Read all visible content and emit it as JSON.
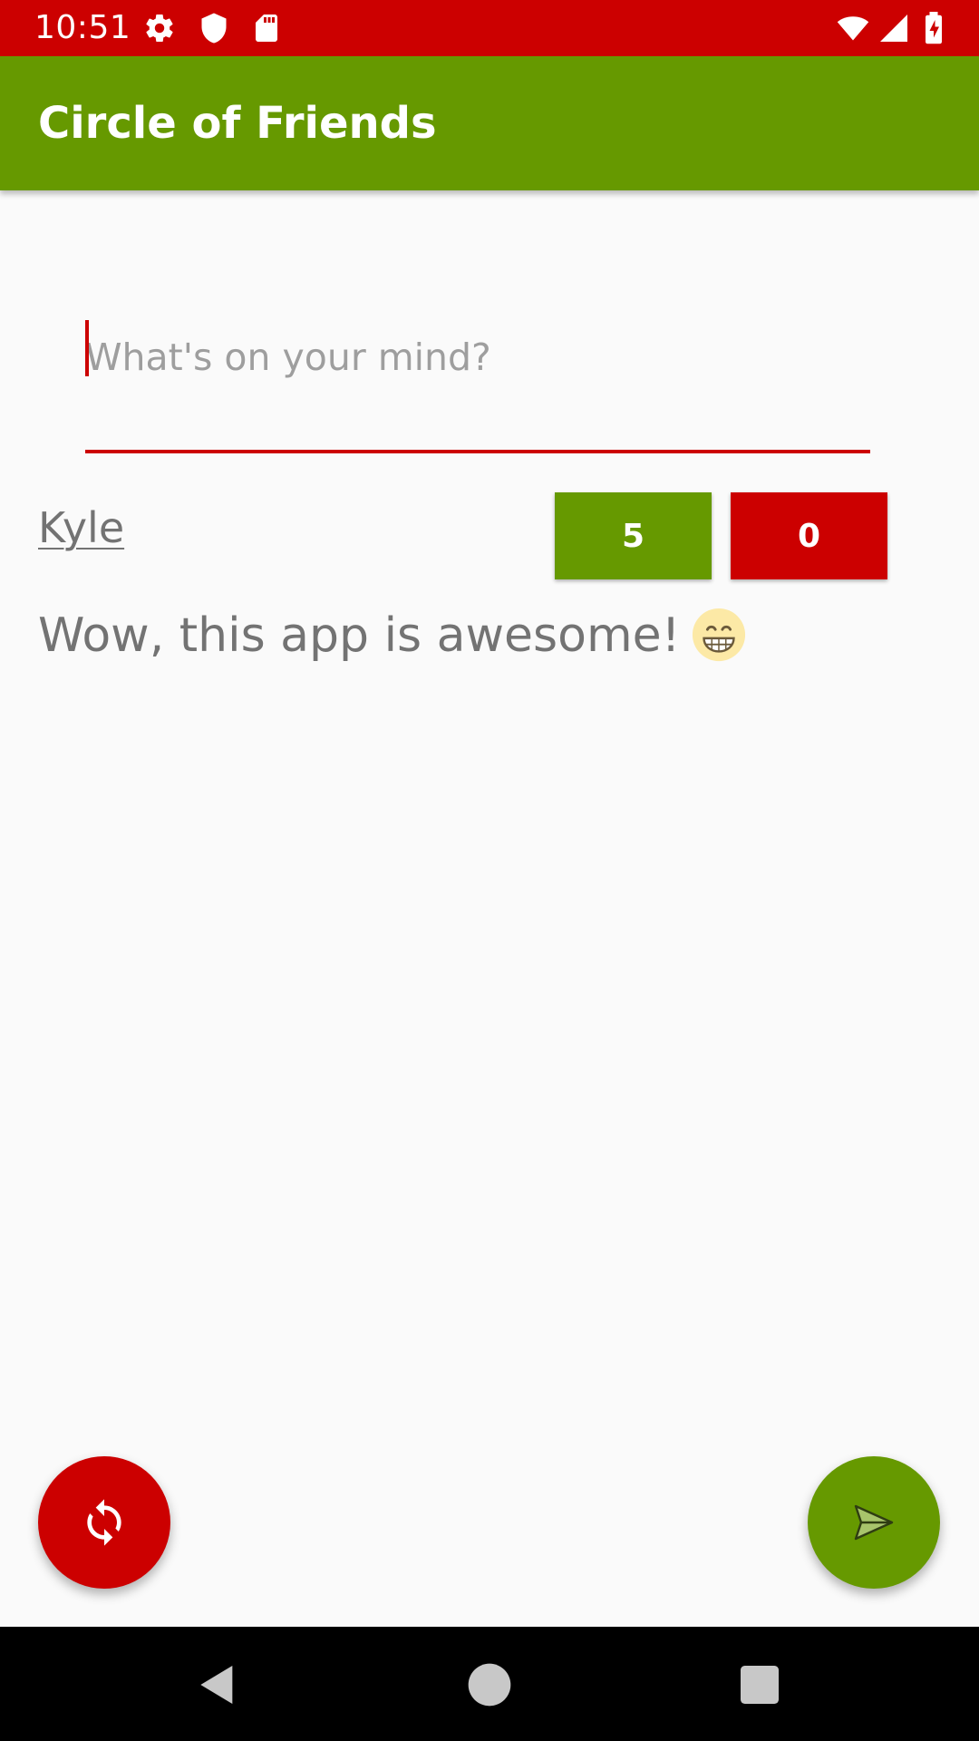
{
  "status_bar": {
    "time": "10:51",
    "icons": [
      "settings-icon",
      "shield-icon",
      "sd-card-icon",
      "wifi-icon",
      "cell-signal-icon",
      "battery-charging-icon"
    ],
    "background": "#cc0000"
  },
  "app_bar": {
    "title": "Circle of Friends",
    "background": "#669900"
  },
  "composer": {
    "placeholder": "What's on your mind?",
    "value": "",
    "accent": "#cc0000"
  },
  "post": {
    "author": "Kyle",
    "text": "Wow, this app is awesome!",
    "emoji": "grinning-face-icon",
    "upvotes": "5",
    "downvotes": "0",
    "upvote_color": "#669900",
    "downvote_color": "#cc0000"
  },
  "fabs": {
    "refresh_icon": "refresh-icon",
    "refresh_color": "#cc0000",
    "send_icon": "send-icon",
    "send_color": "#669900"
  },
  "nav_bar": {
    "icons": [
      "back-icon",
      "home-icon",
      "recents-icon"
    ]
  }
}
